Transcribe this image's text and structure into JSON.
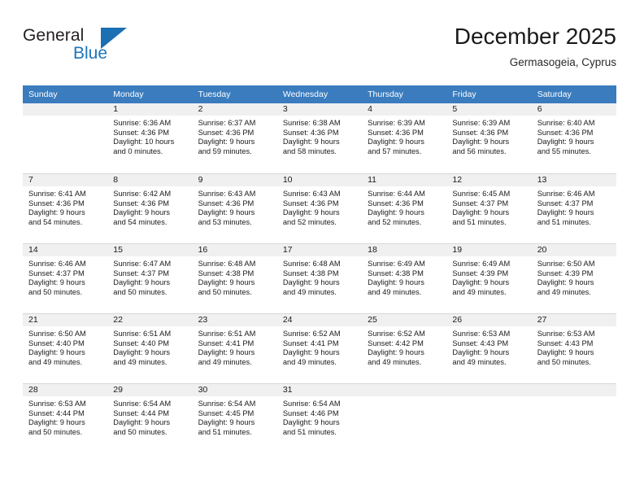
{
  "brand": {
    "name_part1": "General",
    "name_part2": "Blue",
    "logo_icon": "blue-triangle-icon",
    "accent_color": "#1c75bc"
  },
  "header": {
    "title": "December 2025",
    "subtitle": "Germasogeia, Cyprus"
  },
  "calendar": {
    "header_bg": "#3a7cbe",
    "daynum_bg": "#f0f0f0",
    "weekdays": [
      "Sunday",
      "Monday",
      "Tuesday",
      "Wednesday",
      "Thursday",
      "Friday",
      "Saturday"
    ],
    "weeks": [
      [
        {
          "day": "",
          "lines": []
        },
        {
          "day": "1",
          "lines": [
            "Sunrise: 6:36 AM",
            "Sunset: 4:36 PM",
            "Daylight: 10 hours",
            "and 0 minutes."
          ]
        },
        {
          "day": "2",
          "lines": [
            "Sunrise: 6:37 AM",
            "Sunset: 4:36 PM",
            "Daylight: 9 hours",
            "and 59 minutes."
          ]
        },
        {
          "day": "3",
          "lines": [
            "Sunrise: 6:38 AM",
            "Sunset: 4:36 PM",
            "Daylight: 9 hours",
            "and 58 minutes."
          ]
        },
        {
          "day": "4",
          "lines": [
            "Sunrise: 6:39 AM",
            "Sunset: 4:36 PM",
            "Daylight: 9 hours",
            "and 57 minutes."
          ]
        },
        {
          "day": "5",
          "lines": [
            "Sunrise: 6:39 AM",
            "Sunset: 4:36 PM",
            "Daylight: 9 hours",
            "and 56 minutes."
          ]
        },
        {
          "day": "6",
          "lines": [
            "Sunrise: 6:40 AM",
            "Sunset: 4:36 PM",
            "Daylight: 9 hours",
            "and 55 minutes."
          ]
        }
      ],
      [
        {
          "day": "7",
          "lines": [
            "Sunrise: 6:41 AM",
            "Sunset: 4:36 PM",
            "Daylight: 9 hours",
            "and 54 minutes."
          ]
        },
        {
          "day": "8",
          "lines": [
            "Sunrise: 6:42 AM",
            "Sunset: 4:36 PM",
            "Daylight: 9 hours",
            "and 54 minutes."
          ]
        },
        {
          "day": "9",
          "lines": [
            "Sunrise: 6:43 AM",
            "Sunset: 4:36 PM",
            "Daylight: 9 hours",
            "and 53 minutes."
          ]
        },
        {
          "day": "10",
          "lines": [
            "Sunrise: 6:43 AM",
            "Sunset: 4:36 PM",
            "Daylight: 9 hours",
            "and 52 minutes."
          ]
        },
        {
          "day": "11",
          "lines": [
            "Sunrise: 6:44 AM",
            "Sunset: 4:36 PM",
            "Daylight: 9 hours",
            "and 52 minutes."
          ]
        },
        {
          "day": "12",
          "lines": [
            "Sunrise: 6:45 AM",
            "Sunset: 4:37 PM",
            "Daylight: 9 hours",
            "and 51 minutes."
          ]
        },
        {
          "day": "13",
          "lines": [
            "Sunrise: 6:46 AM",
            "Sunset: 4:37 PM",
            "Daylight: 9 hours",
            "and 51 minutes."
          ]
        }
      ],
      [
        {
          "day": "14",
          "lines": [
            "Sunrise: 6:46 AM",
            "Sunset: 4:37 PM",
            "Daylight: 9 hours",
            "and 50 minutes."
          ]
        },
        {
          "day": "15",
          "lines": [
            "Sunrise: 6:47 AM",
            "Sunset: 4:37 PM",
            "Daylight: 9 hours",
            "and 50 minutes."
          ]
        },
        {
          "day": "16",
          "lines": [
            "Sunrise: 6:48 AM",
            "Sunset: 4:38 PM",
            "Daylight: 9 hours",
            "and 50 minutes."
          ]
        },
        {
          "day": "17",
          "lines": [
            "Sunrise: 6:48 AM",
            "Sunset: 4:38 PM",
            "Daylight: 9 hours",
            "and 49 minutes."
          ]
        },
        {
          "day": "18",
          "lines": [
            "Sunrise: 6:49 AM",
            "Sunset: 4:38 PM",
            "Daylight: 9 hours",
            "and 49 minutes."
          ]
        },
        {
          "day": "19",
          "lines": [
            "Sunrise: 6:49 AM",
            "Sunset: 4:39 PM",
            "Daylight: 9 hours",
            "and 49 minutes."
          ]
        },
        {
          "day": "20",
          "lines": [
            "Sunrise: 6:50 AM",
            "Sunset: 4:39 PM",
            "Daylight: 9 hours",
            "and 49 minutes."
          ]
        }
      ],
      [
        {
          "day": "21",
          "lines": [
            "Sunrise: 6:50 AM",
            "Sunset: 4:40 PM",
            "Daylight: 9 hours",
            "and 49 minutes."
          ]
        },
        {
          "day": "22",
          "lines": [
            "Sunrise: 6:51 AM",
            "Sunset: 4:40 PM",
            "Daylight: 9 hours",
            "and 49 minutes."
          ]
        },
        {
          "day": "23",
          "lines": [
            "Sunrise: 6:51 AM",
            "Sunset: 4:41 PM",
            "Daylight: 9 hours",
            "and 49 minutes."
          ]
        },
        {
          "day": "24",
          "lines": [
            "Sunrise: 6:52 AM",
            "Sunset: 4:41 PM",
            "Daylight: 9 hours",
            "and 49 minutes."
          ]
        },
        {
          "day": "25",
          "lines": [
            "Sunrise: 6:52 AM",
            "Sunset: 4:42 PM",
            "Daylight: 9 hours",
            "and 49 minutes."
          ]
        },
        {
          "day": "26",
          "lines": [
            "Sunrise: 6:53 AM",
            "Sunset: 4:43 PM",
            "Daylight: 9 hours",
            "and 49 minutes."
          ]
        },
        {
          "day": "27",
          "lines": [
            "Sunrise: 6:53 AM",
            "Sunset: 4:43 PM",
            "Daylight: 9 hours",
            "and 50 minutes."
          ]
        }
      ],
      [
        {
          "day": "28",
          "lines": [
            "Sunrise: 6:53 AM",
            "Sunset: 4:44 PM",
            "Daylight: 9 hours",
            "and 50 minutes."
          ]
        },
        {
          "day": "29",
          "lines": [
            "Sunrise: 6:54 AM",
            "Sunset: 4:44 PM",
            "Daylight: 9 hours",
            "and 50 minutes."
          ]
        },
        {
          "day": "30",
          "lines": [
            "Sunrise: 6:54 AM",
            "Sunset: 4:45 PM",
            "Daylight: 9 hours",
            "and 51 minutes."
          ]
        },
        {
          "day": "31",
          "lines": [
            "Sunrise: 6:54 AM",
            "Sunset: 4:46 PM",
            "Daylight: 9 hours",
            "and 51 minutes."
          ]
        },
        {
          "day": "",
          "lines": []
        },
        {
          "day": "",
          "lines": []
        },
        {
          "day": "",
          "lines": []
        }
      ]
    ]
  }
}
